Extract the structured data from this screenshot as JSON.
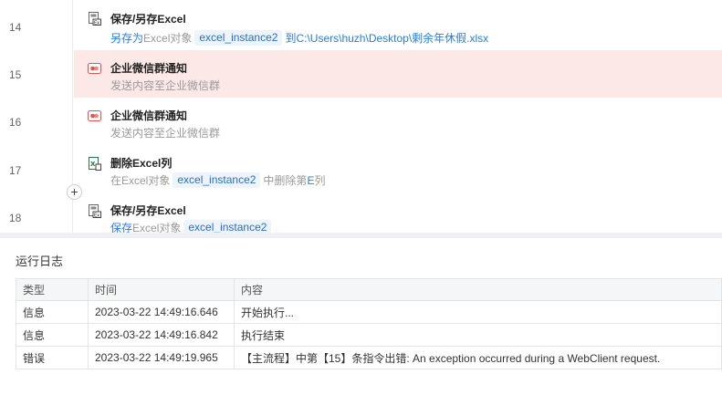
{
  "flow": {
    "rows": [
      {
        "num": "14",
        "icon": "excel-save-icon",
        "title": "保存/另存Excel",
        "desc": {
          "pre": "另存为",
          "mid1": "Excel对象",
          "tag": "excel_instance2",
          "mid2": "到",
          "path": "C:\\Users\\huzh\\Desktop\\剩余年休假.xlsx"
        }
      },
      {
        "num": "15",
        "icon": "wecom-icon",
        "title": "企业微信群通知",
        "desc_text": "发送内容至企业微信群",
        "error": true
      },
      {
        "num": "16",
        "icon": "wecom-icon",
        "title": "企业微信群通知",
        "desc_text": "发送内容至企业微信群"
      },
      {
        "num": "17",
        "icon": "excel-delete-column-icon",
        "title": "删除Excel列",
        "desc": {
          "pre": "在Excel对象",
          "tag": "excel_instance2",
          "post": "中删除第",
          "hl": "E",
          "end": "列"
        }
      },
      {
        "num": "18",
        "icon": "excel-save-icon",
        "title": "保存/另存Excel",
        "desc": {
          "pre": "保存",
          "mid1": "Excel对象",
          "tag": "excel_instance2"
        }
      }
    ],
    "add_button": "+"
  },
  "log": {
    "title": "运行日志",
    "columns": [
      "类型",
      "时间",
      "内容"
    ],
    "rows": [
      [
        "信息",
        "2023-03-22 14:49:16.646",
        "开始执行..."
      ],
      [
        "信息",
        "2023-03-22 14:49:16.842",
        "执行结束"
      ],
      [
        "错误",
        "2023-03-22 14:49:19.965",
        "【主流程】中第【15】条指令出错:  An exception occurred during a WebClient request."
      ]
    ]
  },
  "colors": {
    "accent": "#2b7ae6",
    "error_row": "#fde8e8",
    "wecom_red": "#e8504a",
    "excel_green": "#1f7a3e"
  }
}
